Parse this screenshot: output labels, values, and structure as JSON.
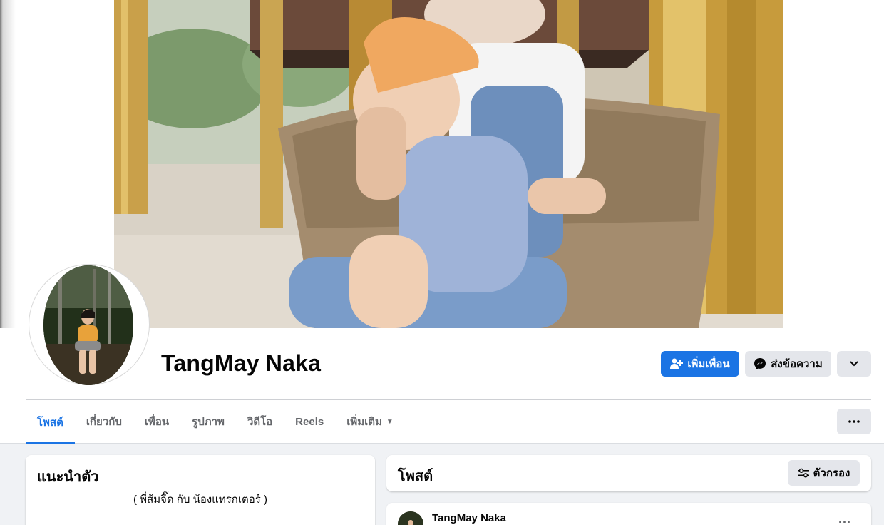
{
  "profile": {
    "name": "TangMay Naka"
  },
  "actions": {
    "add_friend_label": "เพิ่มเพื่อน",
    "message_label": "ส่งข้อความ"
  },
  "tabs": [
    {
      "label": "โพสต์"
    },
    {
      "label": "เกี่ยวกับ"
    },
    {
      "label": "เพื่อน"
    },
    {
      "label": "รูปภาพ"
    },
    {
      "label": "วิดีโอ"
    },
    {
      "label": "Reels"
    },
    {
      "label": "เพิ่มเติม"
    }
  ],
  "intro": {
    "title": "แนะนำตัว",
    "bio": "( พี่ส้มจี๊ด กับ น้องแทรกเตอร์ )"
  },
  "posts": {
    "title": "โพสต์",
    "filter_label": "ตัวกรอง",
    "first_post_author": "TangMay Naka",
    "more_label": "..."
  },
  "icons": {
    "add_friend": "person-plus-icon",
    "message": "messenger-icon",
    "chevron": "chevron-down-icon",
    "tab_more_caret": "caret-down-icon",
    "more": "more-dots-icon",
    "filter": "sliders-icon"
  },
  "colors": {
    "accent": "#1b74e4",
    "secondary_button": "#e4e6eb",
    "page_bg": "#f0f2f5"
  }
}
